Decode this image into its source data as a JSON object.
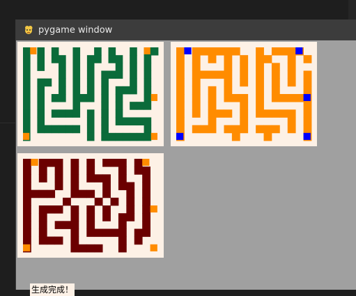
{
  "window": {
    "title": "pygame window",
    "icon": "pygame-snake-icon"
  },
  "status": {
    "message": "生成完成！"
  },
  "colors": {
    "background": "#fdf1e6",
    "window_bg": "#a0a0a0",
    "maze1_wall": "#0b6b3a",
    "maze2_wall": "#ff8c00",
    "maze3_wall": "#6b0000",
    "accent_orange": "#ff8c00",
    "accent_blue": "#0000ff",
    "accent_green": "#0b6b3a",
    "accent_maroon": "#6b0000"
  },
  "mazes": [
    {
      "name": "maze-green",
      "rows": [
        "#.#.#..#..#.#..#.##",
        "#.#.##.#.##.##.#.#.",
        "#.#..#.#.#...#.#.#.",
        "#....#.#.#.###.#.#.",
        "#.##.#.#.#.#...#.#.",
        "#.#..#.#.#.#.###.#.",
        "#.#.##.###.#.#...#.",
        "#.#....#...#.#.###.",
        "#.#.####.#.#.#.....",
        "#.#......#.#.#####.",
        "#.######.#.#.....#.",
        "#........#.#######."
      ]
    },
    {
      "name": "maze-orange",
      "rows": [
        "o.ooo#o#..o.#ooo.",
        "o.#.#.#.o.oo..#.o",
        "o.#...#.o.#.#.#..",
        "o.####o.o.#.o.#.o",
        "o.#...o.o.#.o.#.#",
        "o.#.#.o...#.o...o",
        "o.#.#.ooo.#.ooooo",
        "o.#.#...#.#.....o",
        "o.#.###.#.#####.o",
        "o...#...#.....#.o",
        "o.###.###.###.#.o",
        "o......#...#....o"
      ]
    },
    {
      "name": "maze-maroon",
      "rows": [
        "#.###.#.#.###.#..",
        "#.#.#.#.#...#.##.",
        "#.#.#.#.###.#..#.",
        "#...#.#...#.##.#.",
        "####..###.#..#.#.",
        "#....#...#.#.#.#.",
        "#.###.#.#.#..#.#.",
        "#.#...#.#.#.##.#.",
        "#.#.###.#...#..#.",
        "#.#...#.#####.##.",
        "#.###.#.....#.#..",
        "#.....####..#...."
      ]
    }
  ]
}
